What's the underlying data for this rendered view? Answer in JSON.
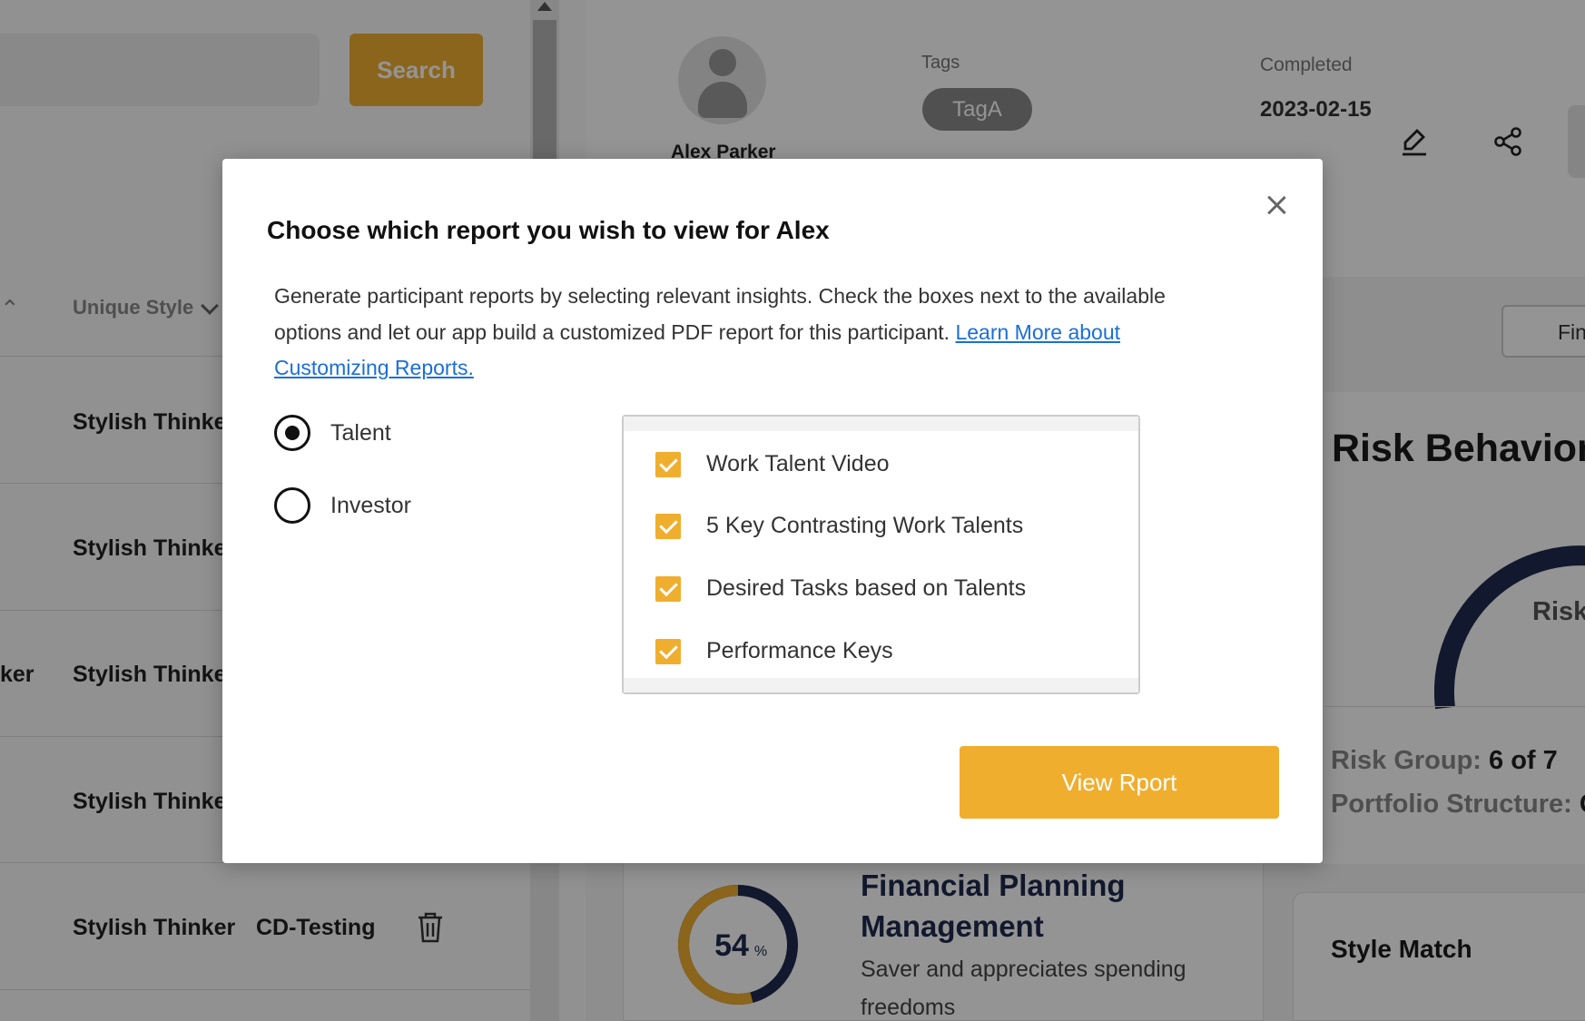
{
  "search": {
    "button_label": "Search"
  },
  "table": {
    "column_header": "Unique Style",
    "rows": [
      {
        "style": "Stylish Thinker",
        "prefix": ""
      },
      {
        "style": "Stylish Thinker",
        "prefix": ""
      },
      {
        "style": "Stylish Thinker",
        "prefix": "ker"
      },
      {
        "style": "Stylish Thinker",
        "prefix": ""
      },
      {
        "style": "Stylish Thinker",
        "tag": "CD-Testing",
        "prefix": ""
      }
    ]
  },
  "profile": {
    "name": "Alex Parker",
    "tags_label": "Tags",
    "tag": "TagA",
    "completed_label": "Completed",
    "completed_date": "2023-02-15"
  },
  "finance_button": "Finan",
  "risk": {
    "title": "Risk Behavior",
    "arc_label": "Risk",
    "group_label": "Risk Group:",
    "group_value": "6 of 7",
    "portfolio_label": "Portfolio Structure:",
    "portfolio_value": "G"
  },
  "fpm": {
    "percent": "54",
    "percent_sign": "%",
    "title_line1": "Financial Planning",
    "title_line2": "Management",
    "desc": "Saver and appreciates spending freedoms"
  },
  "style_match": {
    "title": "Style Match"
  },
  "modal": {
    "title": "Choose which report you wish to view for Alex",
    "description": "Generate participant reports by selecting relevant insights. Check the boxes next to the available options and let our app build a customized PDF report for this participant.",
    "link_text": "Learn More about Customizing Reports.",
    "report_types": [
      {
        "label": "Talent",
        "selected": true
      },
      {
        "label": "Investor",
        "selected": false
      }
    ],
    "options": [
      {
        "label": "Work Talent Video",
        "checked": true
      },
      {
        "label": "5 Key Contrasting Work Talents",
        "checked": true
      },
      {
        "label": "Desired Tasks based on Talents",
        "checked": true
      },
      {
        "label": "Performance Keys",
        "checked": true
      }
    ],
    "view_button": "View Rport"
  },
  "colors": {
    "accent": "#f0ae2f",
    "navy": "#1f2a4e",
    "link": "#1a6fd6"
  }
}
